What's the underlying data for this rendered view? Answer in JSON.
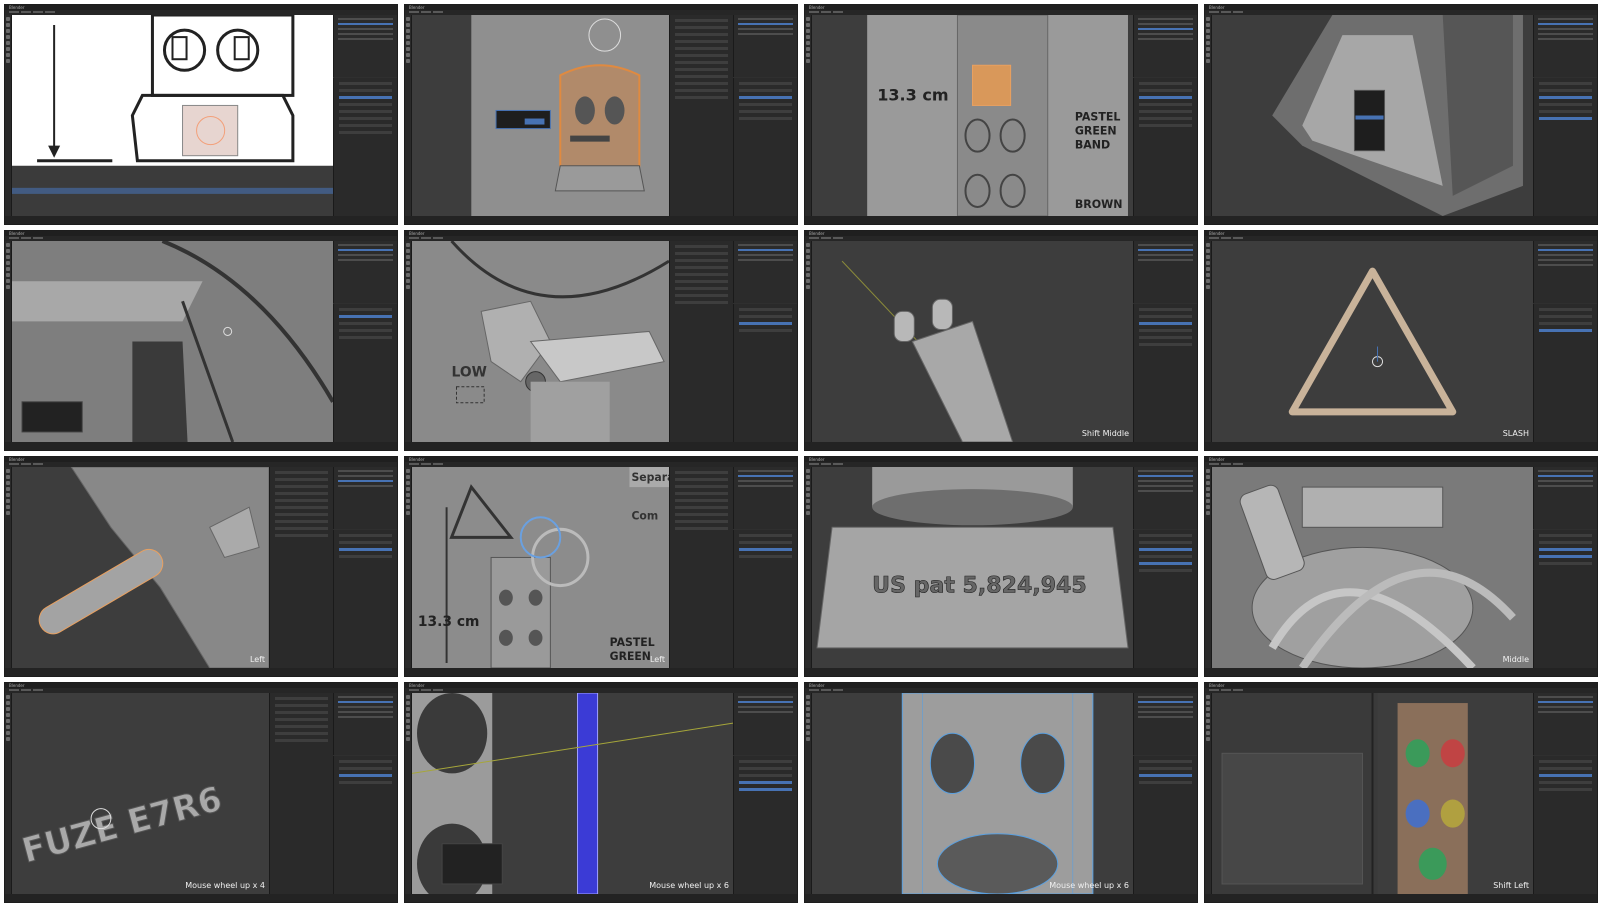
{
  "window_title": "Blender",
  "tiles": [
    {
      "id": 1,
      "label": ""
    },
    {
      "id": 2,
      "label": ""
    },
    {
      "id": 3,
      "label": "13.3 cm",
      "label2": "PASTEL GREEN BAND",
      "label3": "BROWN"
    },
    {
      "id": 4,
      "label": ""
    },
    {
      "id": 5,
      "label": ""
    },
    {
      "id": 6,
      "label": "LOW"
    },
    {
      "id": 7,
      "key": "Shift Middle"
    },
    {
      "id": 8,
      "key": "SLASH"
    },
    {
      "id": 9,
      "key": "Left"
    },
    {
      "id": 10,
      "key": "Left",
      "label": "13.3 cm",
      "label2": "PASTEL GREEN",
      "side1": "Separat",
      "side2": "Com"
    },
    {
      "id": 11,
      "label": "US pat 5,824,945"
    },
    {
      "id": 12,
      "key": "Middle"
    },
    {
      "id": 13,
      "key": "Mouse wheel up x 4",
      "label": "FUZE E7R6"
    },
    {
      "id": 14,
      "key": "Mouse wheel up x 6"
    },
    {
      "id": 15,
      "key": "Mouse wheel up x 6"
    },
    {
      "id": 16,
      "key": "Shift Left"
    }
  ],
  "colors": {
    "ui_dark": "#2b2b2b",
    "viewport": "#3d3d3d",
    "selection": "#4772b3",
    "orange_select": "#e8a060"
  }
}
